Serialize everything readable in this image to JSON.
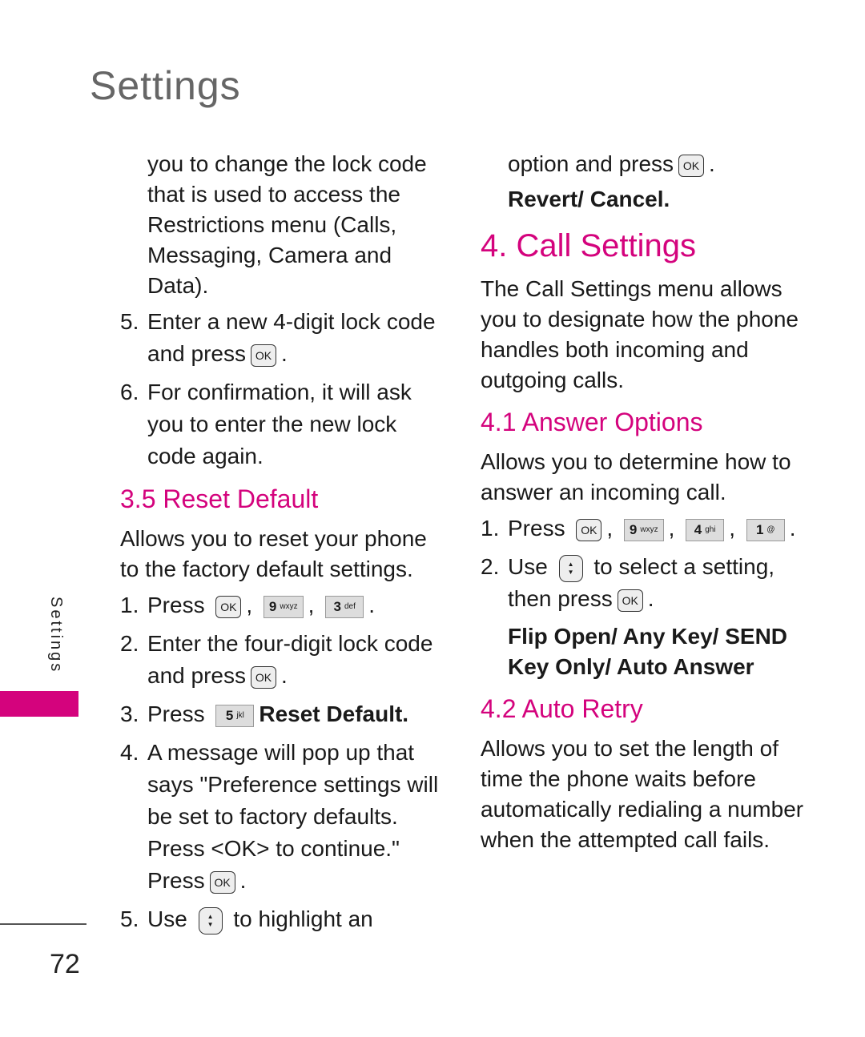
{
  "page": {
    "title": "Settings",
    "side_tab": "Settings",
    "page_number": "72",
    "accent_color": "#d4037d"
  },
  "left": {
    "cont_lines": "you to change the lock code that is used to access the Restrictions menu (Calls, Messaging, Camera and Data).",
    "steps_top": [
      {
        "num": "5.",
        "text_a": "Enter a new 4-digit lock code and press",
        "key": "OK",
        "text_b": "."
      },
      {
        "num": "6.",
        "text": "For confirmation, it will ask you to enter the new lock code again."
      }
    ],
    "section_title": "3.5 Reset Default",
    "section_desc": "Allows you to reset your phone to the factory default settings.",
    "step1": {
      "num": "1.",
      "text": "Press",
      "keys": [
        "OK",
        "9",
        "wxyz",
        "3",
        "def"
      ]
    },
    "step2": {
      "num": "2.",
      "text": "Enter the four-digit lock code and press",
      "key": "OK",
      "end": "."
    },
    "step3": {
      "num": "3.",
      "text": "Press",
      "key_num": "5",
      "key_sub": "jkl",
      "option": "Reset Default."
    },
    "step4": {
      "num": "4.",
      "text": "A message will pop up that says \"Preference settings will be set to factory defaults. Press <OK> to continue.\" Press",
      "key": "OK",
      "end": "."
    },
    "step5": {
      "num": "5.",
      "text_a": "Use",
      "text_b": "to highlight an"
    }
  },
  "right": {
    "cont_line": "option and press",
    "cont_key": "OK",
    "cont_end": ".",
    "cont_options": "Revert/ Cancel.",
    "section_title": "4. Call Settings",
    "section_desc": "The Call Settings menu allows you to designate how the phone handles both incoming and outgoing calls.",
    "sub1_title": "4.1 Answer Options",
    "sub1_desc": "Allows you to determine how to answer an incoming call.",
    "sub1_step1": {
      "num": "1.",
      "text": "Press",
      "keys": [
        "OK",
        "9",
        "wxyz",
        "4",
        "ghi",
        "1",
        "@"
      ]
    },
    "sub1_step2": {
      "num": "2.",
      "text_a": "Use",
      "text_b": "to select a setting, then press",
      "key": "OK",
      "end": "."
    },
    "sub1_options": "Flip Open/ Any Key/ SEND Key Only/ Auto Answer",
    "sub2_title": "4.2 Auto Retry",
    "sub2_desc": "Allows you to set the length of time the phone waits before automatically redialing a number when the attempted call fails."
  }
}
